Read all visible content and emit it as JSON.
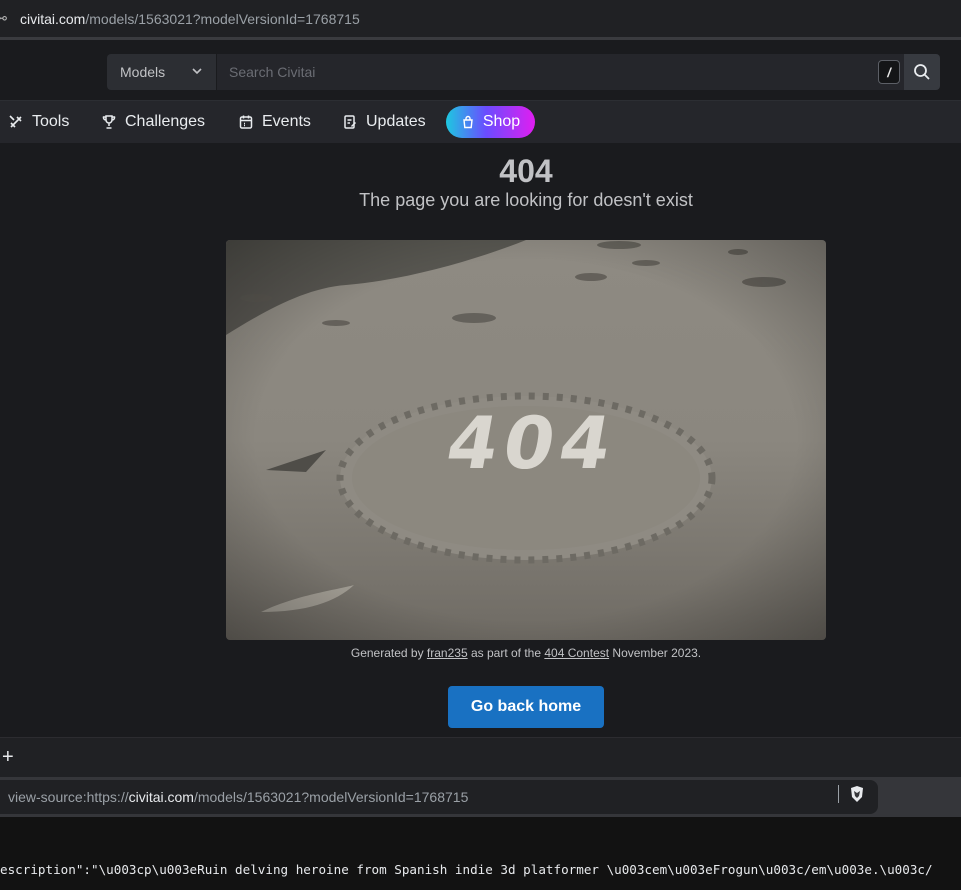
{
  "browser": {
    "url_host": "civitai.com",
    "url_path": "/models/1563021?modelVersionId=1768715"
  },
  "search": {
    "category": "Models",
    "placeholder": "Search Civitai",
    "shortcut_key": "/"
  },
  "nav": {
    "items": [
      {
        "label": "Tools",
        "icon": "tools-icon"
      },
      {
        "label": "Challenges",
        "icon": "trophy-icon"
      },
      {
        "label": "Events",
        "icon": "calendar-icon"
      },
      {
        "label": "Updates",
        "icon": "updates-icon"
      }
    ],
    "shop_label": "Shop"
  },
  "error": {
    "code": "404",
    "message": "The page you are looking for doesn't exist"
  },
  "caption": {
    "prefix": "Generated by",
    "author": "fran235",
    "middle": "as part of the",
    "contest": "404 Contest",
    "suffix": "November 2023."
  },
  "home_button": "Go back home",
  "devtools": {
    "tab_add": "+",
    "source_url_prefix": "view-source:https://",
    "source_url_host": "civitai.com",
    "source_url_path": "/models/1563021?modelVersionId=1768715",
    "source_line": "escription\":\"\\u003cp\\u003eRuin delving heroine from Spanish indie 3d platformer \\u003cem\\u003eFrogun\\u003c/em\\u003e.\\u003c/"
  },
  "colors": {
    "accent_blue": "#1971c2",
    "shop_gradient": [
      "#1ec8e0",
      "#6a4cff",
      "#e01ef0"
    ],
    "background": "#1a1b1e"
  }
}
